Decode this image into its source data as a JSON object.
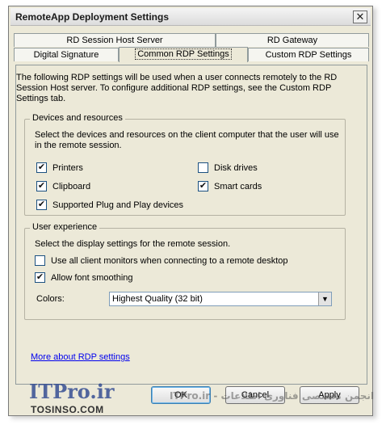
{
  "window": {
    "title": "RemoteApp Deployment Settings",
    "close_label": "✕"
  },
  "tabs": {
    "row_back": [
      "RD Session Host Server",
      "RD Gateway"
    ],
    "row_front": [
      "Digital Signature",
      "Common RDP Settings",
      "Custom RDP Settings"
    ],
    "active": "Common RDP Settings"
  },
  "intro": "The following RDP settings will be used when a user connects remotely to the RD Session Host server.  To configure additional RDP settings, see the Custom RDP Settings tab.",
  "devices": {
    "legend": "Devices and resources",
    "description": "Select the devices and resources on the client computer that the user will use in the remote session.",
    "items": [
      {
        "label": "Printers",
        "checked": true
      },
      {
        "label": "Disk drives",
        "checked": false
      },
      {
        "label": "Clipboard",
        "checked": true
      },
      {
        "label": "Smart cards",
        "checked": true
      },
      {
        "label": "Supported Plug and Play devices",
        "checked": true
      }
    ]
  },
  "experience": {
    "legend": "User experience",
    "description": "Select the display settings for the remote session.",
    "items": [
      {
        "label": "Use all client monitors when connecting to a remote desktop",
        "checked": false
      },
      {
        "label": "Allow font smoothing",
        "checked": true
      }
    ],
    "colors_label": "Colors:",
    "colors_value": "Highest Quality (32 bit)"
  },
  "link": "More about RDP settings",
  "buttons": {
    "ok": "OK",
    "cancel": "Cancel",
    "apply": "Apply"
  },
  "watermark": {
    "brand": "ITPro.ir",
    "site": "TOSINSO.COM",
    "right_text": "ITPro.ir - انجمن تخصصی فناوری اطلاعات"
  },
  "check_mark": "✔"
}
